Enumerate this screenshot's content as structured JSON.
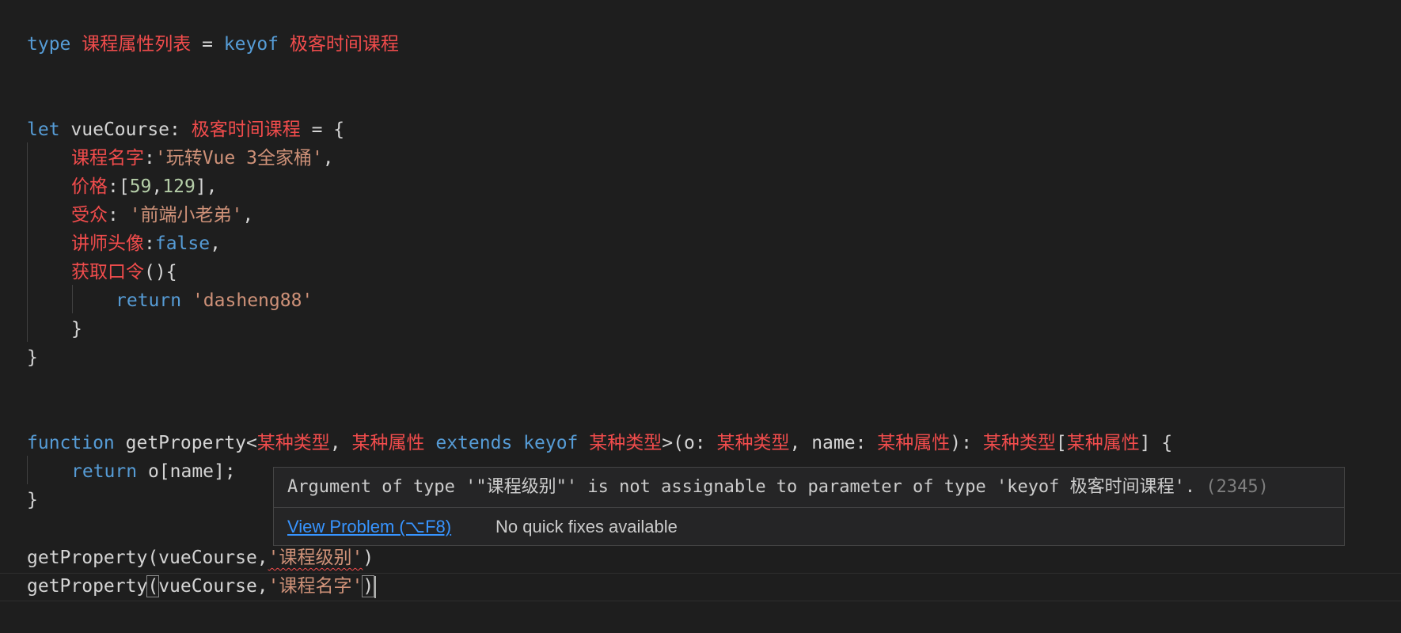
{
  "code": {
    "l1": {
      "k1": "type",
      "t1": "课程属性列表",
      "op": " = ",
      "k2": "keyof",
      "t2": "极客时间课程"
    },
    "l4": {
      "k1": "let",
      "id": "vueCourse",
      "colon": ": ",
      "t1": "极客时间课程",
      "rest": " = {"
    },
    "l5": {
      "p": "课程名字",
      "sep": ":",
      "s": "'玩转Vue 3全家桶'",
      "end": ","
    },
    "l6": {
      "p": "价格",
      "a": ":[",
      "n1": "59",
      "c": ",",
      "n2": "129",
      "end": "],"
    },
    "l7": {
      "p": "受众",
      "sep": ": ",
      "s": "'前端小老弟'",
      "end": ","
    },
    "l8": {
      "p": "讲师头像",
      "sep": ":",
      "k": "false",
      "end": ","
    },
    "l9": {
      "p": "获取口令",
      "end": "(){"
    },
    "l10": {
      "k": "return",
      "s": "'dasheng88'"
    },
    "l11": {
      "t": "}"
    },
    "l12": {
      "t": "}"
    },
    "l15": {
      "k1": "function",
      "fn": " getProperty<",
      "t1": "某种类型",
      "c1": ", ",
      "t2": "某种属性",
      "k2": "extends",
      "k3": "keyof",
      "t3": "某种类型",
      "g1": ">(o: ",
      "t4": "某种类型",
      "g2": ", name: ",
      "t5": "某种属性",
      "g3": "): ",
      "t6": "某种类型",
      "g4": "[",
      "t7": "某种属性",
      "g5": "] {"
    },
    "l16": {
      "k": "return",
      "rest": " o[name];"
    },
    "l17": {
      "t": "}"
    },
    "l19": {
      "fn": "getProperty(vueCourse,",
      "s": "'课程级别'",
      "end": ")"
    },
    "l20": {
      "fn": "getProperty",
      "open": "(",
      "mid": "vueCourse,",
      "s": "'课程名字'",
      "close": ")"
    }
  },
  "hover": {
    "message": "Argument of type '\"课程级别\"' is not assignable to parameter of type 'keyof 极客时间课程'.",
    "code": "(2345)",
    "view_problem": "View Problem (⌥F8)",
    "no_fixes": "No quick fixes available"
  },
  "colors": {
    "background": "#1e1e1e",
    "keyword": "#569cd6",
    "type": "#f14c4c",
    "string": "#ce9178",
    "number": "#b5cea8",
    "link": "#3794ff"
  }
}
